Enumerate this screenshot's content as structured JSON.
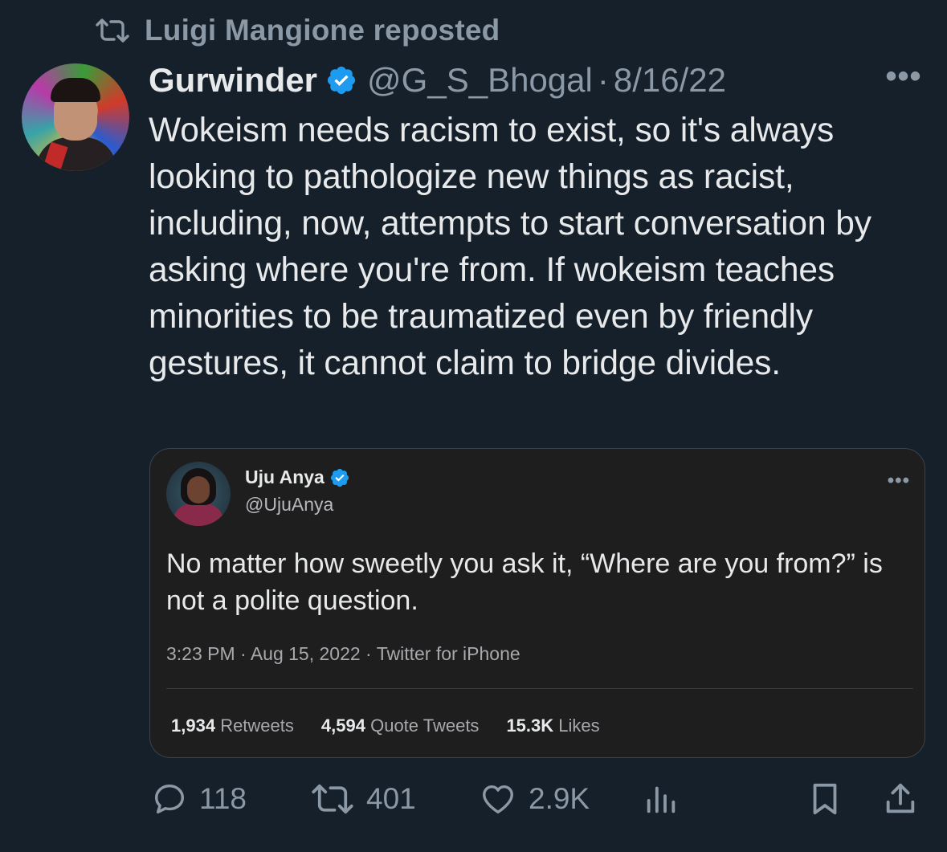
{
  "repost": {
    "label": "Luigi Mangione reposted",
    "icon": "repost-icon"
  },
  "tweet": {
    "author_name": "Gurwinder",
    "handle": "@G_S_Bhogal",
    "separator": "·",
    "date": "8/16/22",
    "more": "•••",
    "text": "Wokeism needs racism to exist, so it's always looking to pathologize new things as racist, including, now, attempts to start conversation by asking where you're from. If wokeism teaches minorities to be traumatized even by friendly gestures, it cannot claim to bridge divides."
  },
  "quote": {
    "name": "Uju Anya",
    "handle": "@UjuAnya",
    "more": "•••",
    "text": "No matter how sweetly you ask it, “Where are you from?” is not a polite question.",
    "meta": "3:23 PM · Aug 15, 2022 · Twitter for iPhone",
    "stats": [
      {
        "value": "1,934",
        "label": "Retweets"
      },
      {
        "value": "4,594",
        "label": "Quote Tweets"
      },
      {
        "value": "15.3K",
        "label": "Likes"
      }
    ]
  },
  "actions": {
    "replies": "118",
    "reposts": "401",
    "likes": "2.9K"
  },
  "colors": {
    "background": "#15202b",
    "verified": "#1d9bf0",
    "muted": "#8b98a5"
  }
}
